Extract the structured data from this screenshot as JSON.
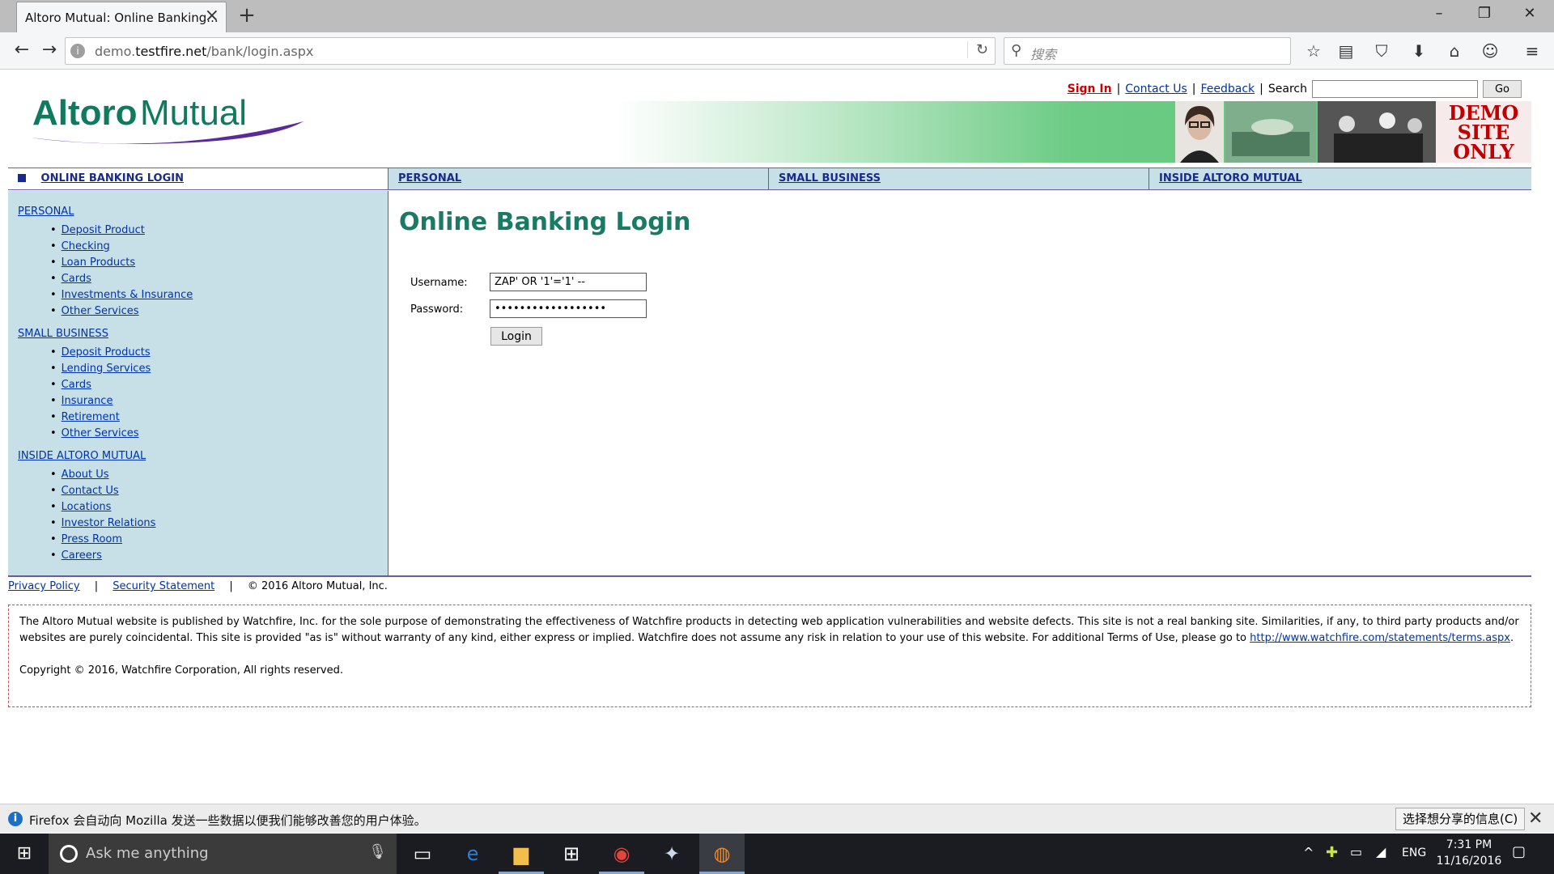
{
  "browser": {
    "tab_title": "Altoro Mutual: Online Banking...",
    "new_tab_symbol": "+",
    "url_host": "demo.testfire.net",
    "url_path": "/bank/login.aspx",
    "url_prefix": "demo.",
    "url_domain": "testfire.net",
    "search_placeholder": "搜索"
  },
  "site": {
    "logo_text": "AltoroMutual",
    "logo_colors": {
      "altoro": "#0f7a5e",
      "swoosh": "#5b2a9a"
    },
    "demo_badge": [
      "DEMO",
      "SITE",
      "ONLY"
    ],
    "toplinks": {
      "sign_in": "Sign In",
      "contact_us": "Contact Us",
      "feedback": "Feedback",
      "search_label": "Search",
      "go": "Go"
    },
    "main_tabs": [
      {
        "label": "ONLINE BANKING LOGIN"
      },
      {
        "label": "PERSONAL"
      },
      {
        "label": "SMALL BUSINESS"
      },
      {
        "label": "INSIDE ALTORO MUTUAL"
      }
    ]
  },
  "sidebar": {
    "sections": [
      {
        "title": "PERSONAL",
        "items": [
          "Deposit Product",
          "Checking",
          "Loan Products",
          "Cards",
          "Investments & Insurance",
          "Other Services"
        ]
      },
      {
        "title": "SMALL BUSINESS",
        "items": [
          "Deposit Products",
          "Lending Services",
          "Cards",
          "Insurance",
          "Retirement",
          "Other Services"
        ]
      },
      {
        "title": "INSIDE ALTORO MUTUAL",
        "items": [
          "About Us",
          "Contact Us",
          "Locations",
          "Investor Relations",
          "Press Room",
          "Careers"
        ]
      }
    ]
  },
  "login": {
    "heading": "Online Banking Login",
    "username_label": "Username:",
    "username_value": "ZAP' OR '1'='1' --",
    "password_label": "Password:",
    "password_value": "••••••••••••••••••",
    "login_button": "Login"
  },
  "footer": {
    "privacy": "Privacy Policy",
    "security": "Security Statement",
    "copyright": "© 2016 Altoro Mutual, Inc.",
    "separator": "|"
  },
  "disclaimer": {
    "text": "The Altoro Mutual website is published by Watchfire, Inc. for the sole purpose of demonstrating the effectiveness of Watchfire products in detecting web application vulnerabilities and website defects. This site is not a real banking site. Similarities, if any, to third party products and/or websites are purely coincidental. This site is provided \"as is\" without warranty of any kind, either express or implied. Watchfire does not assume any risk in relation to your use of this website. For additional Terms of Use, please go to ",
    "link": "http://www.watchfire.com/statements/terms.aspx",
    "link_end": ".",
    "copyright": "Copyright © 2016, Watchfire Corporation, All rights reserved."
  },
  "notification": {
    "message": "Firefox 会自动向 Mozilla 发送一些数据以便我们能够改善您的用户体验。",
    "share_button": "选择想分享的信息(C)"
  },
  "taskbar": {
    "search_text": "Ask me anything",
    "language": "ENG",
    "time": "7:31 PM",
    "date": "11/16/2016"
  }
}
